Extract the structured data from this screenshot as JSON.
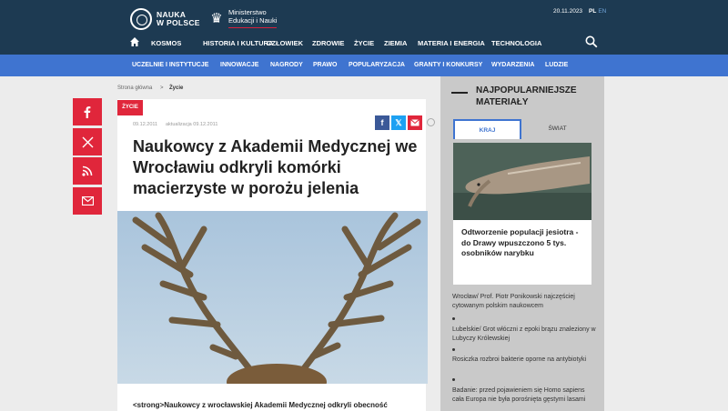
{
  "header": {
    "logo_line1": "NAUKA",
    "logo_line2": "W POLSCE",
    "ministry_line1": "Ministerstwo",
    "ministry_line2": "Edukacji i Nauki",
    "date": "20.11.2023",
    "lang_active": "PL",
    "lang_other": "EN"
  },
  "main_nav": [
    "KOSMOS",
    "HISTORIA I KULTURA",
    "CZŁOWIEK",
    "ZDROWIE",
    "ŻYCIE",
    "ZIEMIA",
    "MATERIA I ENERGIA",
    "TECHNOLOGIA"
  ],
  "sub_nav": [
    "UCZELNIE I INSTYTUCJE",
    "INNOWACJE",
    "NAGRODY",
    "PRAWO",
    "POPULARYZACJA",
    "GRANTY I KONKURSY",
    "WYDARZENIA",
    "LUDZIE"
  ],
  "breadcrumb": {
    "home": "Strona główna",
    "separator": ">",
    "current": "Życie"
  },
  "article": {
    "category": "ŻYCIE",
    "published": "09.12.2011",
    "updated": "aktualizacja 09.12.2011",
    "title": "Naukowcy z Akademii Medycznej we Wrocławiu odkryli komórki macierzyste w porożu jelenia",
    "lead": "<strong>Naukowcy z wrocławskiej Akademii Medycznej odkryli obecność"
  },
  "social_icons": [
    "facebook-icon",
    "x-icon",
    "rss-icon",
    "mail-icon"
  ],
  "sidebar": {
    "title": "NAJPOPULARNIEJSZE MATERIAŁY",
    "tab_active": "KRAJ",
    "tab_other": "ŚWIAT",
    "featured_title": "Odtworzenie populacji jesiotra - do Drawy wpuszczono 5 tys. osobników narybku",
    "items": [
      "Wrocław/ Prof. Piotr Ponikowski najczęściej cytowanym polskim naukowcem",
      "Lubelskie/ Grot włóczni z epoki brązu znaleziony w Lubyczy Królewskiej",
      "Rosiczka rozbroi bakterie oporne na antybiotyki",
      "Badanie: przed pojawieniem się Homo sapiens cała Europa nie była porośnięta gęstymi lasami"
    ]
  },
  "colors": {
    "header_bg": "#1d3a52",
    "subnav_bg": "#3f74d0",
    "accent_red": "#e0263b",
    "sidebar_bg": "#c9c9c9"
  }
}
